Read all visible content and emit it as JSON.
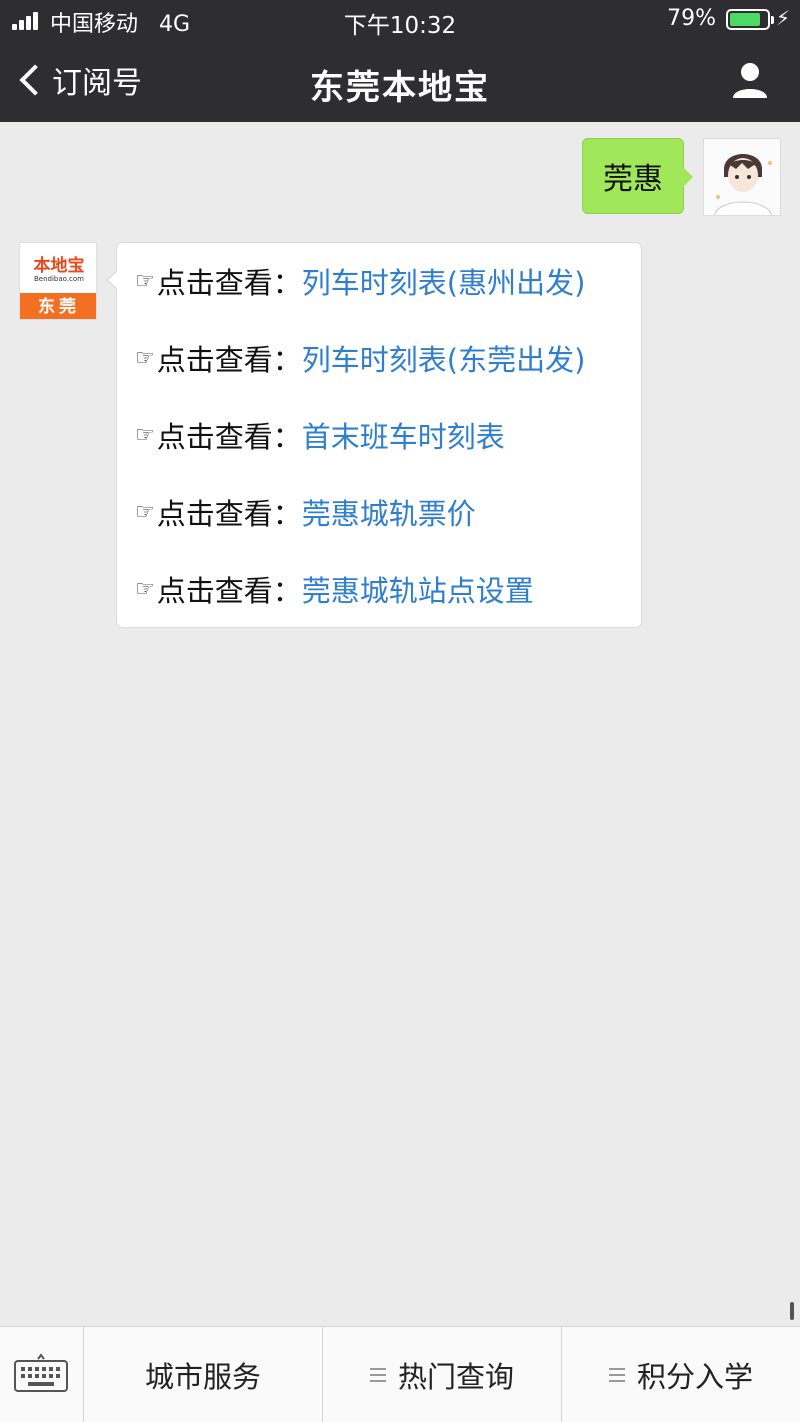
{
  "status_bar": {
    "carrier": "中国移动",
    "network": "4G",
    "time": "下午10:32",
    "battery_percent": "79%",
    "battery_color": "#4cd964"
  },
  "nav": {
    "back_label": "订阅号",
    "title": "东莞本地宝",
    "profile_icon": "person-icon"
  },
  "messages": {
    "user": {
      "text": "莞惠"
    },
    "bot": {
      "logo": {
        "brand": "本地宝",
        "url": "Bendibao.com",
        "city": "东莞"
      },
      "items": [
        {
          "bullet": "☞",
          "prefix": "点击查看：",
          "link": "列车时刻表(惠州出发)"
        },
        {
          "bullet": "☞",
          "prefix": "点击查看：",
          "link": "列车时刻表(东莞出发)"
        },
        {
          "bullet": "☞",
          "prefix": "点击查看：",
          "link": "首末班车时刻表"
        },
        {
          "bullet": "☞",
          "prefix": "点击查看：",
          "link": "莞惠城轨票价"
        },
        {
          "bullet": "☞",
          "prefix": "点击查看：",
          "link": "莞惠城轨站点设置"
        }
      ],
      "link_color": "#2f7fd1"
    }
  },
  "menu": {
    "keyboard_icon": "keyboard-icon",
    "items": [
      {
        "label": "城市服务",
        "has_submenu": false
      },
      {
        "label": "热门查询",
        "has_submenu": true
      },
      {
        "label": "积分入学",
        "has_submenu": true
      }
    ]
  }
}
